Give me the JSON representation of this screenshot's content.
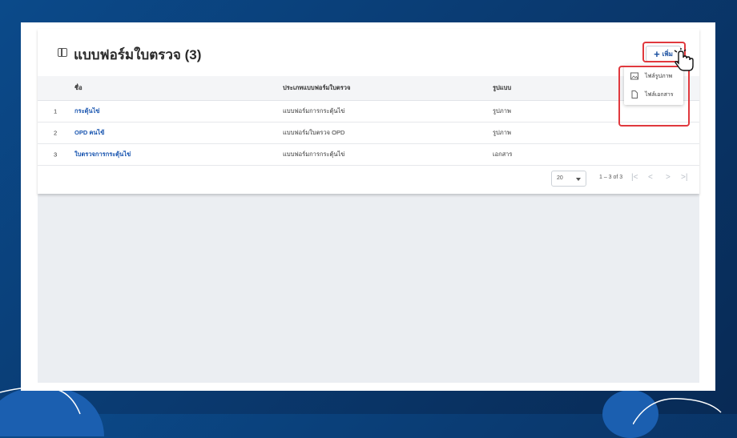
{
  "page": {
    "title": "แบบฟอร์มใบตรวจ (3)"
  },
  "toolbar": {
    "add_label": "เพิ่ม",
    "add_icon": "plus-icon"
  },
  "add_menu": {
    "items": [
      {
        "label": "ไฟล์รูปภาพ",
        "icon": "image-icon"
      },
      {
        "label": "ไฟล์เอกสาร",
        "icon": "document-icon"
      }
    ]
  },
  "table": {
    "columns": [
      "ชื่อ",
      "ประเภทแบบฟอร์มใบตรวจ",
      "รูปแบบ"
    ],
    "rows": [
      {
        "index": "1",
        "name": "กระดุ้นไข่",
        "type": "แบบฟอร์มการกระตุ้นไข่",
        "format": "รูปภาพ"
      },
      {
        "index": "2",
        "name": "OPD คนไข้",
        "type": "แบบฟอร์มใบตรวจ OPD",
        "format": "รูปภาพ"
      },
      {
        "index": "3",
        "name": "ใบตรวจการกระตุ้นไข่",
        "type": "แบบฟอร์มการกระตุ้นไข่",
        "format": "เอกสาร"
      }
    ]
  },
  "pagination": {
    "page_size": "20",
    "range": "1 – 3 of 3"
  },
  "colors": {
    "accent": "#1a56b0",
    "highlight": "#e0393e",
    "background": "#0a3b72"
  }
}
